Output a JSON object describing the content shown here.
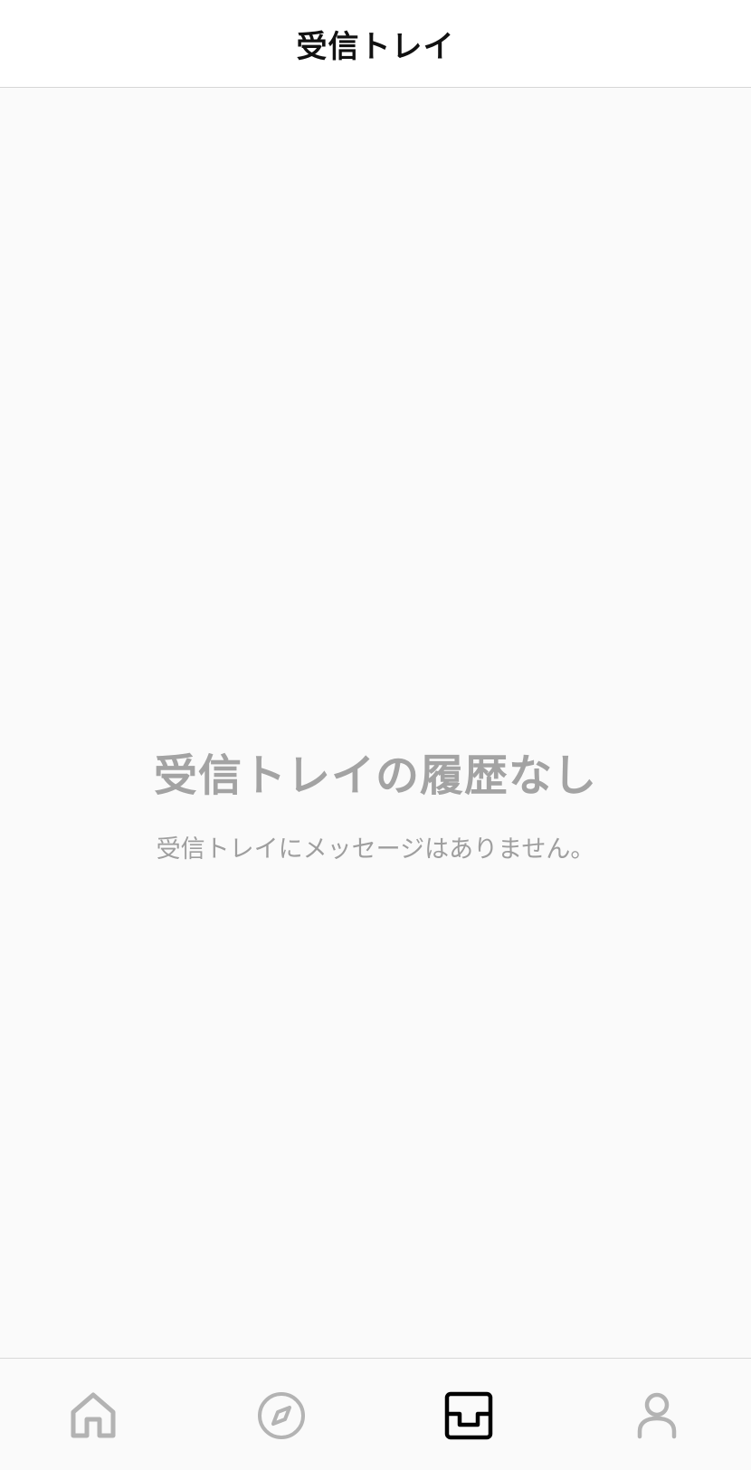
{
  "header": {
    "title": "受信トレイ"
  },
  "empty_state": {
    "title": "受信トレイの履歴なし",
    "subtitle": "受信トレイにメッセージはありません。"
  },
  "tabbar": {
    "items": [
      {
        "icon": "home-icon",
        "active": false
      },
      {
        "icon": "compass-icon",
        "active": false
      },
      {
        "icon": "inbox-icon",
        "active": true
      },
      {
        "icon": "user-icon",
        "active": false
      }
    ]
  },
  "colors": {
    "active_icon": "#000000",
    "inactive_icon": "#b3b3b3",
    "empty_text": "#a3a3a3",
    "background": "#fafafa"
  }
}
